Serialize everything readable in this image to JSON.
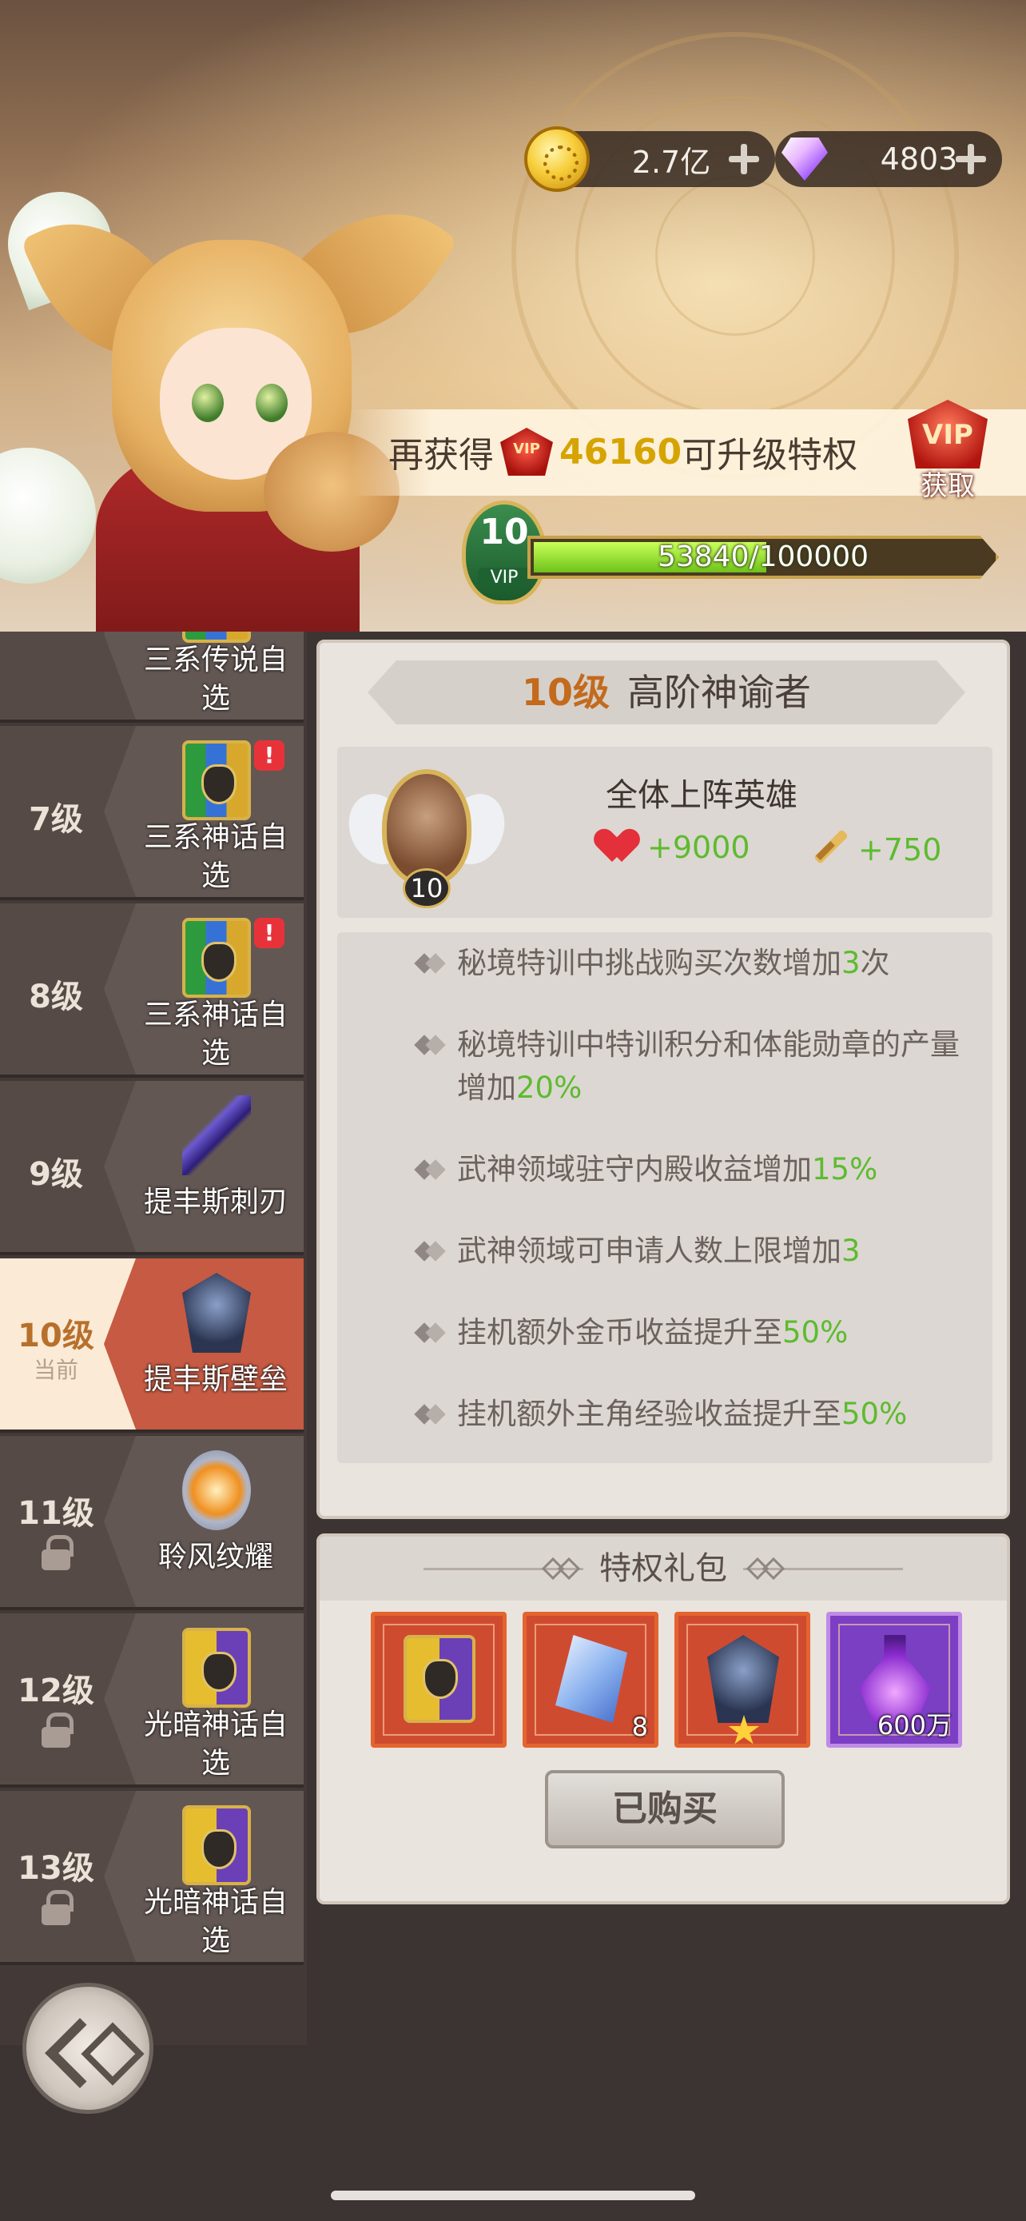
{
  "currencies": {
    "gold": {
      "value": "2.7亿",
      "icon": "gold-coin-icon"
    },
    "gems": {
      "value": "4803",
      "icon": "diamond-icon"
    }
  },
  "progress_banner": {
    "prefix": "再获得",
    "vip_icon_text": "VIP",
    "amount": "46160",
    "suffix": "可升级特权",
    "obtain_vip_text": "VIP",
    "obtain_label": "获取"
  },
  "vip": {
    "level": "10",
    "badge_text": "VIP",
    "progress_text": "53840/100000",
    "progress_fraction": 0.5384
  },
  "level_list": [
    {
      "label": "",
      "sub": "",
      "name": "三系传说自选",
      "icon": "card-icon",
      "locked": false,
      "alert": false
    },
    {
      "label": "7级",
      "sub": "",
      "name": "三系神话自选",
      "icon": "card-icon",
      "locked": false,
      "alert": true
    },
    {
      "label": "8级",
      "sub": "",
      "name": "三系神话自选",
      "icon": "card-icon",
      "locked": false,
      "alert": true
    },
    {
      "label": "9级",
      "sub": "",
      "name": "提丰斯刺刃",
      "icon": "dagger-icon",
      "locked": false,
      "alert": false
    },
    {
      "label": "10级",
      "sub": "当前",
      "name": "提丰斯壁垒",
      "icon": "helm-icon",
      "locked": false,
      "alert": false,
      "current": true
    },
    {
      "label": "11级",
      "sub": "",
      "name": "聆风纹耀",
      "icon": "orb-icon",
      "locked": true,
      "alert": false
    },
    {
      "label": "12级",
      "sub": "",
      "name": "光暗神话自选",
      "icon": "card-icon",
      "locked": true,
      "alert": false
    },
    {
      "label": "13级",
      "sub": "",
      "name": "光暗神话自选",
      "icon": "card-icon",
      "locked": true,
      "alert": false
    }
  ],
  "detail": {
    "title_level": "10级",
    "title_name": "高阶神谕者",
    "emblem_level": "10",
    "hero_target": "全体上阵英雄",
    "hp_bonus": "+9000",
    "atk_bonus": "+750",
    "perks": [
      {
        "text": "秘境特训中挑战购买次数增加",
        "highlight": "3",
        "after": "次"
      },
      {
        "text": "秘境特训中特训积分和体能勋章的产量增加",
        "highlight": "20%",
        "after": ""
      },
      {
        "text": "武神领域驻守内殿收益增加",
        "highlight": "15%",
        "after": ""
      },
      {
        "text": "武神领域可申请人数上限增加",
        "highlight": "3",
        "after": ""
      },
      {
        "text": "挂机额外金币收益提升至",
        "highlight": "50%",
        "after": ""
      },
      {
        "text": "挂机额外主角经验收益提升至",
        "highlight": "50%",
        "after": ""
      }
    ]
  },
  "pack": {
    "title": "特权礼包",
    "items": [
      {
        "icon": "hero-card-icon",
        "count": ""
      },
      {
        "icon": "crystal-icon",
        "count": "8"
      },
      {
        "icon": "helm-icon",
        "count": ""
      },
      {
        "icon": "potion-icon",
        "count": "600万"
      }
    ],
    "button": "已购买"
  }
}
